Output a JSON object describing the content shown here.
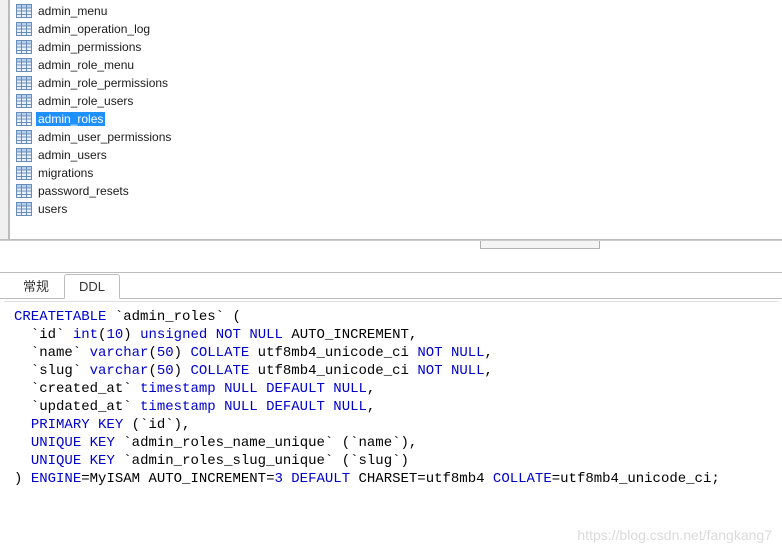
{
  "tree": {
    "items": [
      {
        "name": "admin_menu",
        "selected": false
      },
      {
        "name": "admin_operation_log",
        "selected": false
      },
      {
        "name": "admin_permissions",
        "selected": false
      },
      {
        "name": "admin_role_menu",
        "selected": false
      },
      {
        "name": "admin_role_permissions",
        "selected": false
      },
      {
        "name": "admin_role_users",
        "selected": false
      },
      {
        "name": "admin_roles",
        "selected": true
      },
      {
        "name": "admin_user_permissions",
        "selected": false
      },
      {
        "name": "admin_users",
        "selected": false
      },
      {
        "name": "migrations",
        "selected": false
      },
      {
        "name": "password_resets",
        "selected": false
      },
      {
        "name": "users",
        "selected": false
      }
    ]
  },
  "tabs": {
    "items": [
      {
        "label": "常规",
        "active": false
      },
      {
        "label": "DDL",
        "active": true
      }
    ]
  },
  "ddl": {
    "tokens": [
      [
        [
          "kw",
          "CREATE"
        ],
        [
          "",
          ""
        ],
        [
          "kw",
          "TABLE"
        ],
        [
          "",
          " `admin_roles` ("
        ]
      ],
      [
        [
          "",
          "  `id` "
        ],
        [
          "kw",
          "int"
        ],
        [
          "",
          "("
        ],
        [
          "num",
          "10"
        ],
        [
          "",
          ") "
        ],
        [
          "kw",
          "unsigned"
        ],
        [
          "",
          " "
        ],
        [
          "kw",
          "NOT"
        ],
        [
          "",
          " "
        ],
        [
          "kw",
          "NULL"
        ],
        [
          "",
          " AUTO_INCREMENT,"
        ]
      ],
      [
        [
          "",
          "  `name` "
        ],
        [
          "kw",
          "varchar"
        ],
        [
          "",
          "("
        ],
        [
          "num",
          "50"
        ],
        [
          "",
          ") "
        ],
        [
          "kw",
          "COLLATE"
        ],
        [
          "",
          " utf8mb4_unicode_ci "
        ],
        [
          "kw",
          "NOT"
        ],
        [
          "",
          " "
        ],
        [
          "kw",
          "NULL"
        ],
        [
          "",
          ","
        ]
      ],
      [
        [
          "",
          "  `slug` "
        ],
        [
          "kw",
          "varchar"
        ],
        [
          "",
          "("
        ],
        [
          "num",
          "50"
        ],
        [
          "",
          ") "
        ],
        [
          "kw",
          "COLLATE"
        ],
        [
          "",
          " utf8mb4_unicode_ci "
        ],
        [
          "kw",
          "NOT"
        ],
        [
          "",
          " "
        ],
        [
          "kw",
          "NULL"
        ],
        [
          "",
          ","
        ]
      ],
      [
        [
          "",
          "  `created_at` "
        ],
        [
          "kw",
          "timestamp"
        ],
        [
          "",
          " "
        ],
        [
          "kw",
          "NULL"
        ],
        [
          "",
          " "
        ],
        [
          "kw",
          "DEFAULT"
        ],
        [
          "",
          " "
        ],
        [
          "kw",
          "NULL"
        ],
        [
          "",
          ","
        ]
      ],
      [
        [
          "",
          "  `updated_at` "
        ],
        [
          "kw",
          "timestamp"
        ],
        [
          "",
          " "
        ],
        [
          "kw",
          "NULL"
        ],
        [
          "",
          " "
        ],
        [
          "kw",
          "DEFAULT"
        ],
        [
          "",
          " "
        ],
        [
          "kw",
          "NULL"
        ],
        [
          "",
          ","
        ]
      ],
      [
        [
          "",
          "  "
        ],
        [
          "kw",
          "PRIMARY"
        ],
        [
          "",
          " "
        ],
        [
          "kw",
          "KEY"
        ],
        [
          "",
          " (`id`),"
        ]
      ],
      [
        [
          "",
          "  "
        ],
        [
          "kw",
          "UNIQUE"
        ],
        [
          "",
          " "
        ],
        [
          "kw",
          "KEY"
        ],
        [
          "",
          " `admin_roles_name_unique` (`name`),"
        ]
      ],
      [
        [
          "",
          "  "
        ],
        [
          "kw",
          "UNIQUE"
        ],
        [
          "",
          " "
        ],
        [
          "kw",
          "KEY"
        ],
        [
          "",
          " `admin_roles_slug_unique` (`slug`)"
        ]
      ],
      [
        [
          "",
          ") "
        ],
        [
          "kw",
          "ENGINE"
        ],
        [
          "",
          "=MyISAM AUTO_INCREMENT="
        ],
        [
          "num",
          "3"
        ],
        [
          "",
          " "
        ],
        [
          "kw",
          "DEFAULT"
        ],
        [
          "",
          " CHARSET=utf8mb4 "
        ],
        [
          "kw",
          "COLLATE"
        ],
        [
          "",
          "=utf8mb4_unicode_ci;"
        ]
      ]
    ]
  },
  "watermark": "https://blog.csdn.net/fangkang7"
}
